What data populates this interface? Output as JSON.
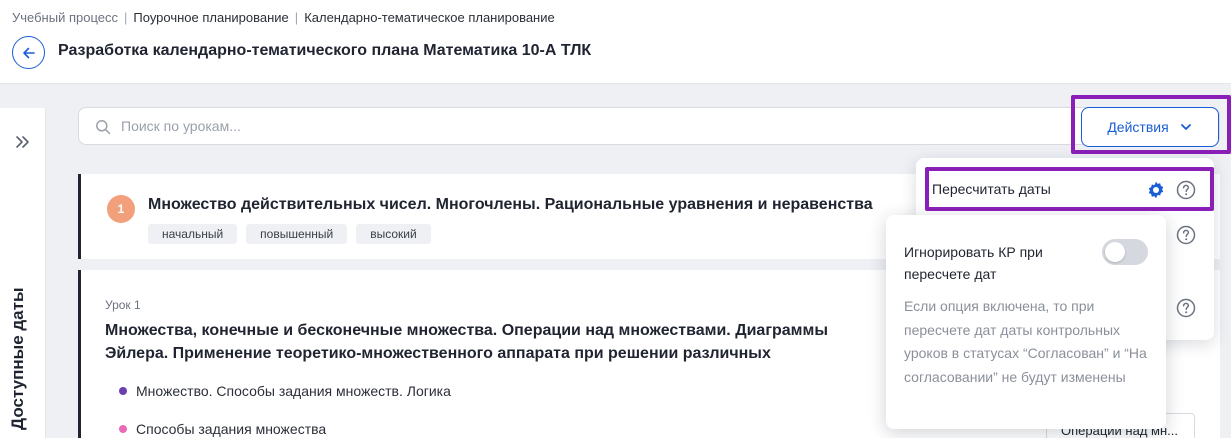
{
  "header": {
    "breadcrumb": [
      "Учебный процесс",
      "Поурочное планирование",
      "Календарно-тематическое планирование"
    ],
    "title": "Разработка календарно-тематического плана Математика 10-А ТЛК"
  },
  "sidebar": {
    "title": "Доступные даты"
  },
  "search": {
    "placeholder": "Поиск по урокам..."
  },
  "actions": {
    "label": "Действия",
    "menu": {
      "recalculate_label": "Пересчитать даты"
    }
  },
  "popover": {
    "option_label": "Игнорировать КР при пересчете дат",
    "toggle_on": false,
    "description": "Если опция включена, то при пересчете дат даты контрольных уроков в статусах “Согласован” и “На согласовании” не будут изменены"
  },
  "module": {
    "number": "1",
    "title": "Множество действительных чисел. Многочлены. Рациональные уравнения и неравенства",
    "tags": [
      "начальный",
      "повышенный",
      "высокий"
    ]
  },
  "lesson": {
    "label": "Урок 1",
    "title": "Множества, конечные и бесконечные множества. Операции над множествами. Диаграммы Эйлера. Применение теоретико-множественного аппарата при решении различных предметных задач",
    "topics": [
      {
        "text": "Множество. Способы задания множеств. Логика",
        "color": "#6b3fb0"
      },
      {
        "text": "Способы задания множества",
        "color": "#e86ab8"
      }
    ],
    "chip": "Операции над мн..."
  },
  "colors": {
    "accent": "#1a5dd6",
    "highlight": "#8a1fb8",
    "module_badge": "#f2a07b"
  }
}
